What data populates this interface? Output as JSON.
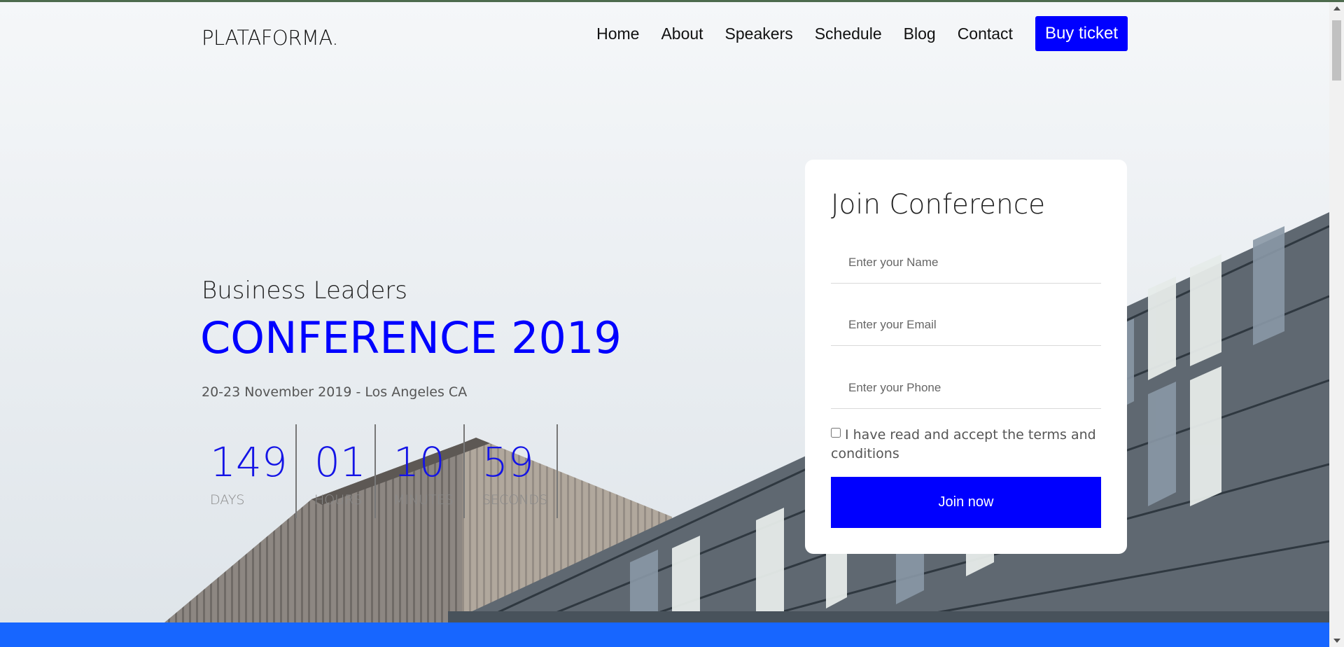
{
  "brand": {
    "logo": "PLATAFORMA."
  },
  "nav": {
    "items": [
      {
        "label": "Home"
      },
      {
        "label": "About"
      },
      {
        "label": "Speakers"
      },
      {
        "label": "Schedule"
      },
      {
        "label": "Blog"
      },
      {
        "label": "Contact"
      }
    ],
    "cta": "Buy ticket"
  },
  "hero": {
    "subtitle": "Business Leaders",
    "title": "CONFERENCE 2019",
    "date": "20-23 November 2019 - Los Angeles CA"
  },
  "countdown": [
    {
      "value": "149",
      "label": "DAYS"
    },
    {
      "value": "01",
      "label": "HOURS"
    },
    {
      "value": "10",
      "label": "MINUTES"
    },
    {
      "value": "59",
      "label": "SECONDS"
    }
  ],
  "form": {
    "title": "Join Conference",
    "name_placeholder": "Enter your Name",
    "email_placeholder": "Enter your Email",
    "phone_placeholder": "Enter your Phone",
    "terms_label": "I have read and accept the terms and conditions",
    "submit_label": "Join now"
  },
  "colors": {
    "accent": "#0000ff",
    "band": "#1766ff"
  }
}
